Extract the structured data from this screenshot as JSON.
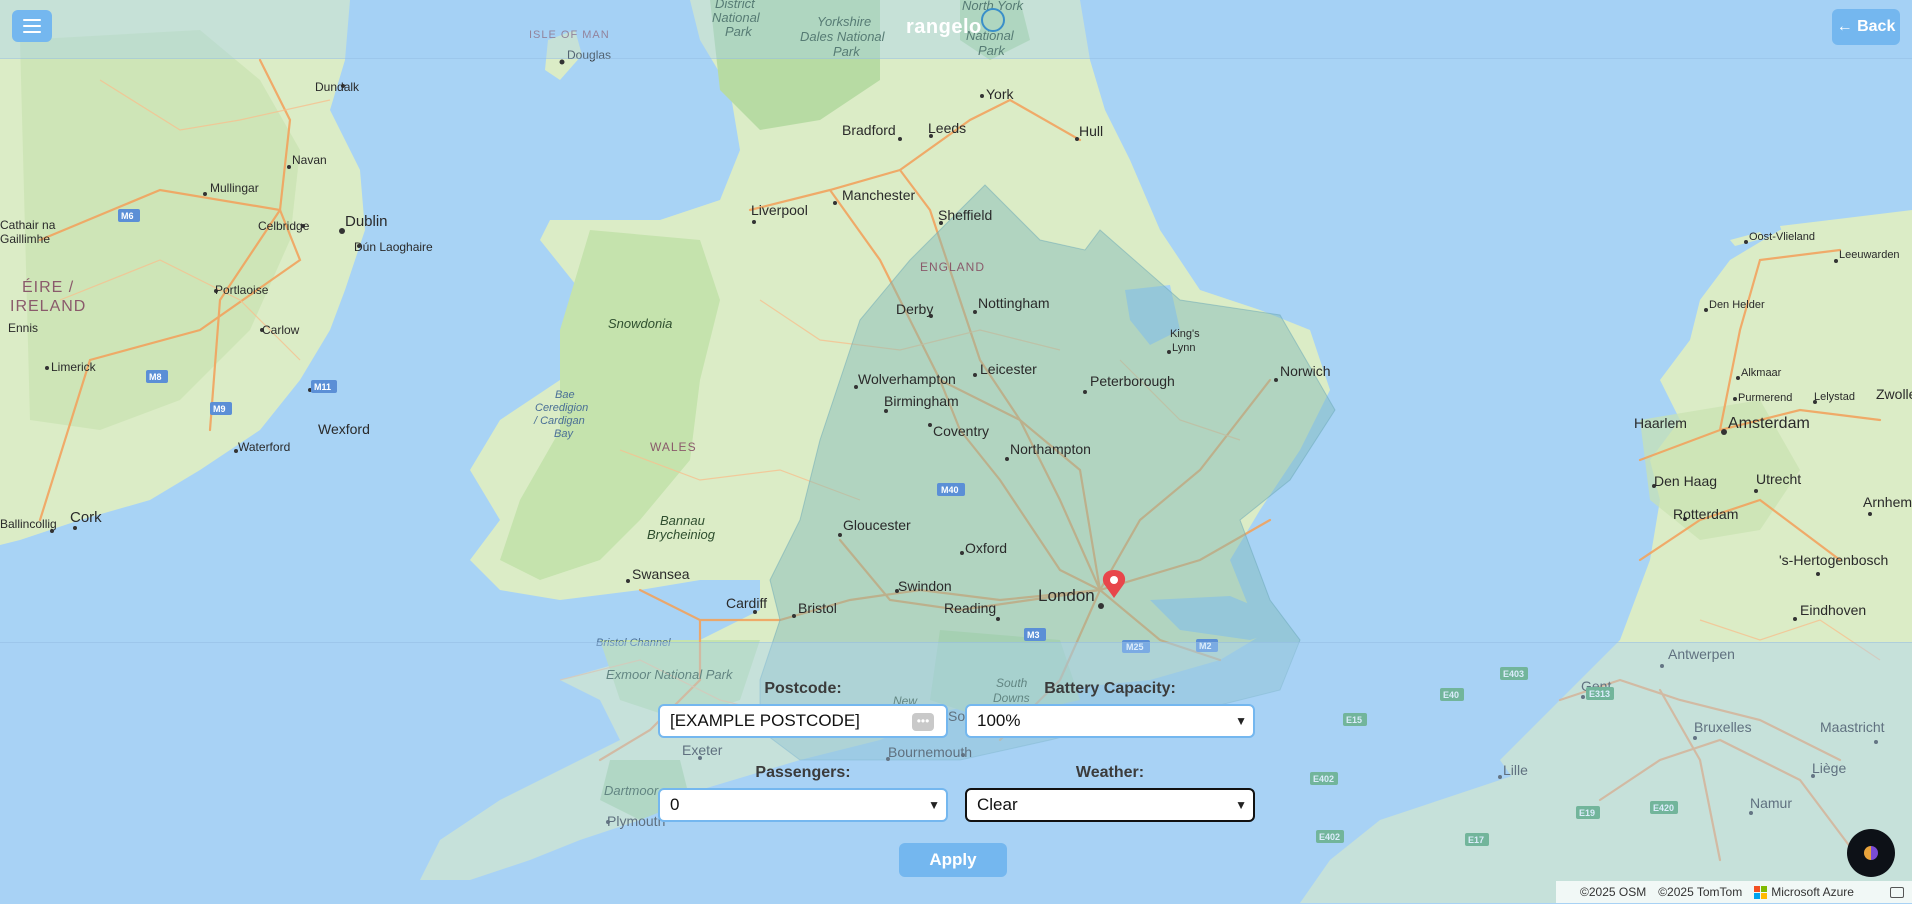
{
  "header": {
    "logo_text": "rangelo",
    "back_label": "← Back",
    "menu_icon": "hamburger-icon"
  },
  "map": {
    "labels": {
      "isle_of_man": "ISLE OF MAN",
      "douglas": "Douglas",
      "dundalk": "Dundalk",
      "navan": "Navan",
      "mullingar": "Mullingar",
      "celbridge": "Celbridge",
      "dublin": "Dublin",
      "dun_laoghaire": "Dún Laoghaire",
      "cathair": "Cathair na",
      "gaillimhe": "Gaillimhe",
      "eire": "ÉIRE /",
      "ireland": "IRELAND",
      "ennis": "Ennis",
      "portlaoise": "Portlaoise",
      "carlow": "Carlow",
      "limerick": "Limerick",
      "wexford": "Wexford",
      "waterford": "Waterford",
      "ballincollig": "Ballincollig",
      "cork": "Cork",
      "district": "District",
      "national": "National",
      "park": "Park",
      "yorkshire": "Yorkshire",
      "dales_np": "Dales National",
      "park2": "Park",
      "north_york": "North York",
      "national2": "National",
      "park3": "Park",
      "york": "York",
      "hull": "Hull",
      "bradford": "Bradford",
      "leeds": "Leeds",
      "manchester": "Manchester",
      "liverpool": "Liverpool",
      "sheffield": "Sheffield",
      "england": "ENGLAND",
      "derby": "Derby",
      "nottingham": "Nottingham",
      "kings_lynn_1": "King's",
      "kings_lynn_2": "Lynn",
      "norwich": "Norwich",
      "snowdonia": "Snowdonia",
      "wolverhampton": "Wolverhampton",
      "leicester": "Leicester",
      "peterborough": "Peterborough",
      "birmingham": "Birmingham",
      "coventry": "Coventry",
      "bae_1": "Bae",
      "bae_2": "Ceredigion",
      "bae_3": "/ Cardigan",
      "bae_4": "Bay",
      "wales": "WALES",
      "northampton": "Northampton",
      "bannau_1": "Bannau",
      "bannau_2": "Brycheiniog",
      "gloucester": "Gloucester",
      "oxford": "Oxford",
      "swansea": "Swansea",
      "swindon": "Swindon",
      "cardiff": "Cardiff",
      "bristol": "Bristol",
      "reading": "Reading",
      "london": "London",
      "bristol_channel": "Bristol Channel",
      "exmoor": "Exmoor National Park",
      "south_downs_1": "South",
      "south_downs_2": "Downs",
      "new": "New",
      "exeter": "Exeter",
      "bournemouth": "Bournemouth",
      "dartmoor": "Dartmoor",
      "plymouth": "Plymouth",
      "so": "So",
      "oost_vlieland": "Oost-Vlieland",
      "leeuwarden": "Leeuwarden",
      "den_helder": "Den Helder",
      "alkmaar": "Alkmaar",
      "purmerend": "Purmerend",
      "lelystad": "Lelystad",
      "zwolle": "Zwolle",
      "haarlem": "Haarlem",
      "amsterdam": "Amsterdam",
      "den_haag": "Den Haag",
      "utrecht": "Utrecht",
      "arnhem": "Arnhem",
      "rotterdam": "Rotterdam",
      "s_hertogenbosch": "'s-Hertogenbosch",
      "eindhoven": "Eindhoven",
      "antwerpen": "Antwerpen",
      "gent": "Gent",
      "bruxelles": "Bruxelles",
      "maastricht": "Maastricht",
      "lille": "Lille",
      "liege": "Liège",
      "namur": "Namur"
    },
    "road_shields": {
      "m6": "M6",
      "m8": "M8",
      "m11": "M11",
      "m9": "M9",
      "m40": "M40",
      "m3": "M3",
      "m25": "M25",
      "m2": "M2",
      "e403": "E403",
      "e40": "E40",
      "e313": "E313",
      "e15": "E15",
      "e402": "E402",
      "e402b": "E402",
      "e19": "E19",
      "e420": "E420",
      "e17": "E17"
    },
    "range_fill_color": "#7fb8b8",
    "marker_color": "#e8464b"
  },
  "form": {
    "postcode_label": "Postcode:",
    "postcode_value": "[EXAMPLE POSTCODE]",
    "battery_label": "Battery Capacity:",
    "battery_value": "100%",
    "passengers_label": "Passengers:",
    "passengers_value": "0",
    "weather_label": "Weather:",
    "weather_value": "Clear",
    "apply_label": "Apply"
  },
  "attribution": {
    "osm": "©2025 OSM",
    "tomtom": "©2025 TomTom",
    "azure": "Microsoft Azure"
  },
  "colors": {
    "accent": "#74b7ef",
    "sea": "#a8d3f5",
    "land": "#eef0e4",
    "park_green": "#b7dba3",
    "motorway": "#f2a35e"
  }
}
